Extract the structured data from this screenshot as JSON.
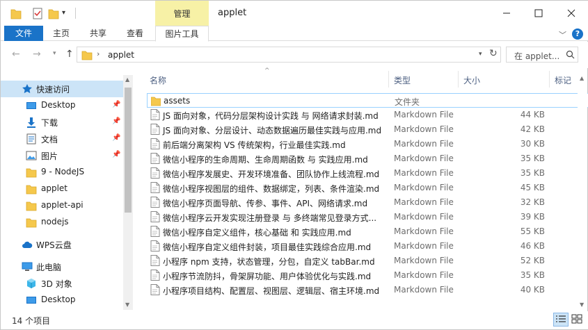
{
  "window": {
    "title": "applet",
    "context_tab": "管理",
    "colors": {
      "accent": "#1a73c8",
      "context_tab": "#f7f1a6",
      "selection": "#cce4f7",
      "folder": "#f5c84c"
    }
  },
  "ribbon": {
    "tabs": [
      {
        "label": "文件"
      },
      {
        "label": "主页"
      },
      {
        "label": "共享"
      },
      {
        "label": "查看"
      },
      {
        "label": "图片工具"
      }
    ],
    "help_label": "?"
  },
  "address": {
    "path": "applet",
    "search_placeholder": "在 applet..."
  },
  "nav": {
    "items": [
      {
        "label": "快速访问",
        "icon": "star-icon"
      },
      {
        "label": "Desktop",
        "icon": "desktop-icon",
        "pinned": true
      },
      {
        "label": "下载",
        "icon": "download-icon",
        "pinned": true
      },
      {
        "label": "文档",
        "icon": "document-icon",
        "pinned": true
      },
      {
        "label": "图片",
        "icon": "picture-icon",
        "pinned": true
      },
      {
        "label": "9 - NodeJS",
        "icon": "folder-icon"
      },
      {
        "label": "applet",
        "icon": "folder-icon"
      },
      {
        "label": "applet-api",
        "icon": "folder-icon"
      },
      {
        "label": "nodejs",
        "icon": "folder-icon"
      },
      {
        "label": "WPS云盘",
        "icon": "cloud-icon"
      },
      {
        "label": "此电脑",
        "icon": "computer-icon"
      },
      {
        "label": "3D 对象",
        "icon": "cube-icon"
      },
      {
        "label": "Desktop",
        "icon": "desktop-icon"
      }
    ]
  },
  "list": {
    "columns": [
      {
        "label": "名称"
      },
      {
        "label": "类型"
      },
      {
        "label": "大小"
      },
      {
        "label": "标记"
      }
    ],
    "rows": [
      {
        "name": "assets",
        "type": "文件夹",
        "size": "",
        "kind": "folder"
      },
      {
        "name": "JS 面向对象，代码分层架构设计实践 与 网络请求封装.md",
        "type": "Markdown File",
        "size": "44 KB",
        "kind": "md"
      },
      {
        "name": "JS 面向对象、分层设计、动态数据遍历最佳实践与应用.md",
        "type": "Markdown File",
        "size": "42 KB",
        "kind": "md"
      },
      {
        "name": "前后端分离架构 VS 传统架构，行业最佳实践.md",
        "type": "Markdown File",
        "size": "30 KB",
        "kind": "md"
      },
      {
        "name": "微信小程序的生命周期、生命周期函数 与 实践应用.md",
        "type": "Markdown File",
        "size": "35 KB",
        "kind": "md"
      },
      {
        "name": "微信小程序发展史、开发环境准备、团队协作上线流程.md",
        "type": "Markdown File",
        "size": "35 KB",
        "kind": "md"
      },
      {
        "name": "微信小程序视图层的组件、数据绑定，列表、条件渲染.md",
        "type": "Markdown File",
        "size": "45 KB",
        "kind": "md"
      },
      {
        "name": "微信小程序页面导航、传参、事件、API、网络请求.md",
        "type": "Markdown File",
        "size": "32 KB",
        "kind": "md"
      },
      {
        "name": "微信小程序云开发实现注册登录 与 多终端常见登录方式...",
        "type": "Markdown File",
        "size": "39 KB",
        "kind": "md"
      },
      {
        "name": "微信小程序自定义组件，核心基础 和 实践应用.md",
        "type": "Markdown File",
        "size": "55 KB",
        "kind": "md"
      },
      {
        "name": "微信小程序自定义组件封装，项目最佳实践综合应用.md",
        "type": "Markdown File",
        "size": "46 KB",
        "kind": "md"
      },
      {
        "name": "小程序 npm 支持，状态管理，分包，自定义 tabBar.md",
        "type": "Markdown File",
        "size": "52 KB",
        "kind": "md"
      },
      {
        "name": "小程序节流防抖，骨架屏功能、用户体验优化与实践.md",
        "type": "Markdown File",
        "size": "35 KB",
        "kind": "md"
      },
      {
        "name": "小程序项目结构、配置层、视图层、逻辑层、宿主环境.md",
        "type": "Markdown File",
        "size": "40 KB",
        "kind": "md"
      }
    ]
  },
  "status": {
    "count": "14 个项目"
  }
}
